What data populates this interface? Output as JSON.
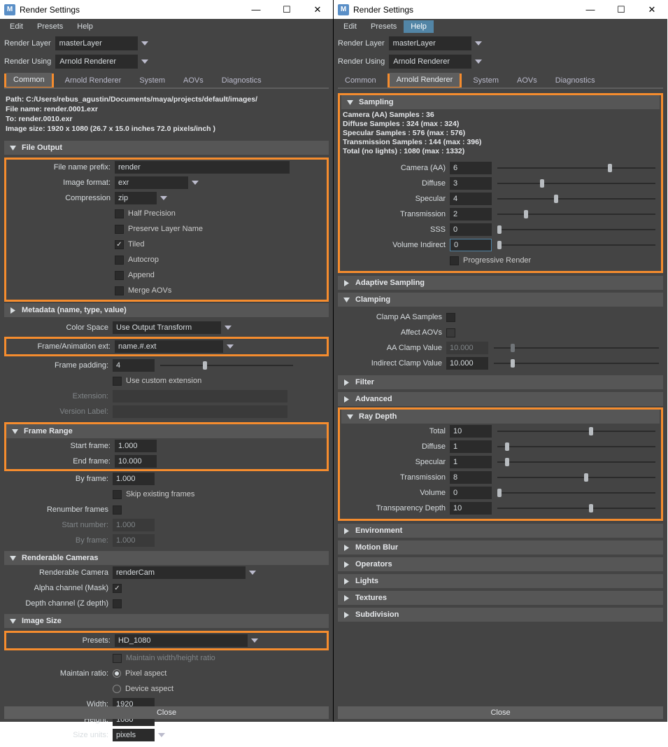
{
  "title": "Render Settings",
  "title_icon": "M",
  "winbtns": {
    "min": "—",
    "max": "☐",
    "close": "✕"
  },
  "menu": {
    "edit": "Edit",
    "presets": "Presets",
    "help": "Help"
  },
  "render_layer_label": "Render Layer",
  "render_layer_value": "masterLayer",
  "render_using_label": "Render Using",
  "render_using_value": "Arnold Renderer",
  "tabs": [
    "Common",
    "Arnold Renderer",
    "System",
    "AOVs",
    "Diagnostics"
  ],
  "left": {
    "path_line": "Path: C:/Users/rebus_agustin/Documents/maya/projects/default/images/",
    "filename_line": "File name:  render.0001.exr",
    "to_line": "To:               render.0010.exr",
    "size_line": "Image size: 1920 x 1080 (26.7 x 15.0 inches 72.0 pixels/inch )",
    "sections": {
      "file_output": {
        "title": "File Output",
        "file_name_prefix_label": "File name prefix:",
        "file_name_prefix": "render",
        "image_format_label": "Image format:",
        "image_format": "exr",
        "compression_label": "Compression",
        "compression": "zip",
        "half_precision": "Half Precision",
        "preserve_layer_name": "Preserve Layer Name",
        "tiled": "Tiled",
        "autocrop": "Autocrop",
        "append": "Append",
        "merge_aovs": "Merge AOVs",
        "metadata_title": "Metadata (name, type, value)",
        "color_space_label": "Color Space",
        "color_space": "Use Output Transform",
        "frame_anim_label": "Frame/Animation ext:",
        "frame_anim": "name.#.ext",
        "frame_padding_label": "Frame padding:",
        "frame_padding": "4",
        "use_custom_ext": "Use custom extension",
        "extension_label": "Extension:",
        "version_label_label": "Version Label:"
      },
      "frame_range": {
        "title": "Frame Range",
        "start_label": "Start frame:",
        "start": "1.000",
        "end_label": "End frame:",
        "end": "10.000",
        "by_label": "By frame:",
        "by": "1.000",
        "skip": "Skip existing frames",
        "renumber_label": "Renumber frames",
        "start_number_label": "Start number:",
        "start_number": "1.000",
        "by2_label": "By frame:",
        "by2": "1.000"
      },
      "renderable_cameras": {
        "title": "Renderable Cameras",
        "camera_label": "Renderable Camera",
        "camera": "renderCam",
        "alpha_label": "Alpha channel (Mask)",
        "depth_label": "Depth channel (Z depth)"
      },
      "image_size": {
        "title": "Image Size",
        "presets_label": "Presets:",
        "presets": "HD_1080",
        "maintain_wh": "Maintain width/height ratio",
        "maintain_ratio_label": "Maintain ratio:",
        "pixel_aspect": "Pixel aspect",
        "device_aspect": "Device aspect",
        "width_label": "Width:",
        "width": "1920",
        "height_label": "Height:",
        "height": "1080",
        "size_units_label": "Size units:",
        "size_units": "pixels"
      }
    }
  },
  "right": {
    "sections": {
      "sampling": {
        "title": "Sampling",
        "info_camera": "Camera (AA) Samples : 36",
        "info_diffuse": "Diffuse Samples : 324 (max : 324)",
        "info_specular": "Specular Samples : 576 (max : 576)",
        "info_transmission": "Transmission Samples : 144 (max : 396)",
        "info_total": "Total (no lights) : 1080 (max : 1332)",
        "camera_label": "Camera (AA)",
        "camera": "6",
        "diffuse_label": "Diffuse",
        "diffuse": "3",
        "specular_label": "Specular",
        "specular": "4",
        "transmission_label": "Transmission",
        "transmission": "2",
        "sss_label": "SSS",
        "sss": "0",
        "volume_indirect_label": "Volume Indirect",
        "volume_indirect": "0",
        "progressive": "Progressive Render"
      },
      "adaptive": {
        "title": "Adaptive Sampling"
      },
      "clamping": {
        "title": "Clamping",
        "clamp_aa_label": "Clamp AA Samples",
        "affect_aovs_label": "Affect AOVs",
        "aa_clamp_label": "AA Clamp Value",
        "aa_clamp": "10.000",
        "indirect_clamp_label": "Indirect Clamp Value",
        "indirect_clamp": "10.000"
      },
      "filter": {
        "title": "Filter"
      },
      "advanced": {
        "title": "Advanced"
      },
      "ray_depth": {
        "title": "Ray Depth",
        "total_label": "Total",
        "total": "10",
        "diffuse_label": "Diffuse",
        "diffuse": "1",
        "specular_label": "Specular",
        "specular": "1",
        "transmission_label": "Transmission",
        "transmission": "8",
        "volume_label": "Volume",
        "volume": "0",
        "transparency_label": "Transparency Depth",
        "transparency": "10"
      },
      "collapsed": [
        "Environment",
        "Motion Blur",
        "Operators",
        "Lights",
        "Textures",
        "Subdivision"
      ]
    }
  },
  "close": "Close",
  "slider_positions": {
    "camera": 70,
    "diffuse": 27,
    "specular": 36,
    "transmission": 17,
    "sss": 0,
    "volume_indirect": 0,
    "indirect_clamp": 10,
    "aa_clamp": 10,
    "rd_total": 58,
    "rd_diffuse": 5,
    "rd_specular": 5,
    "rd_transmission": 55,
    "rd_volume": 0,
    "rd_transparency": 58,
    "frame_padding": 32
  }
}
